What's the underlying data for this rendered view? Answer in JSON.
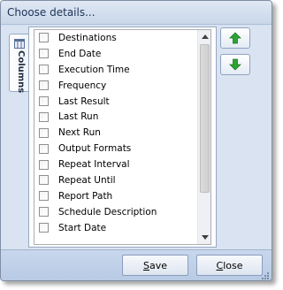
{
  "dialog": {
    "title": "Choose details..."
  },
  "tab": {
    "label": "Columns",
    "icon": "columns-icon"
  },
  "list": {
    "items": [
      {
        "label": "Destinations",
        "checked": false
      },
      {
        "label": "End Date",
        "checked": false
      },
      {
        "label": "Execution Time",
        "checked": false
      },
      {
        "label": "Frequency",
        "checked": false
      },
      {
        "label": "Last Result",
        "checked": false
      },
      {
        "label": "Last Run",
        "checked": false
      },
      {
        "label": "Next Run",
        "checked": false
      },
      {
        "label": "Output Formats",
        "checked": false
      },
      {
        "label": "Repeat Interval",
        "checked": false
      },
      {
        "label": "Repeat Until",
        "checked": false
      },
      {
        "label": "Report Path",
        "checked": false
      },
      {
        "label": "Schedule Description",
        "checked": false
      },
      {
        "label": "Start Date",
        "checked": false
      }
    ]
  },
  "buttons": {
    "move_up_icon": "arrow-up-icon",
    "move_down_icon": "arrow-down-icon",
    "save_label": "Save",
    "save_mnemonic": "S",
    "save_rest": "ave",
    "close_label": "Close",
    "close_mnemonic": "C",
    "close_rest": "lose"
  },
  "colors": {
    "arrow_green": "#2ca334",
    "dialog_bg": "#d5e0ef",
    "title_text": "#1e3256"
  }
}
